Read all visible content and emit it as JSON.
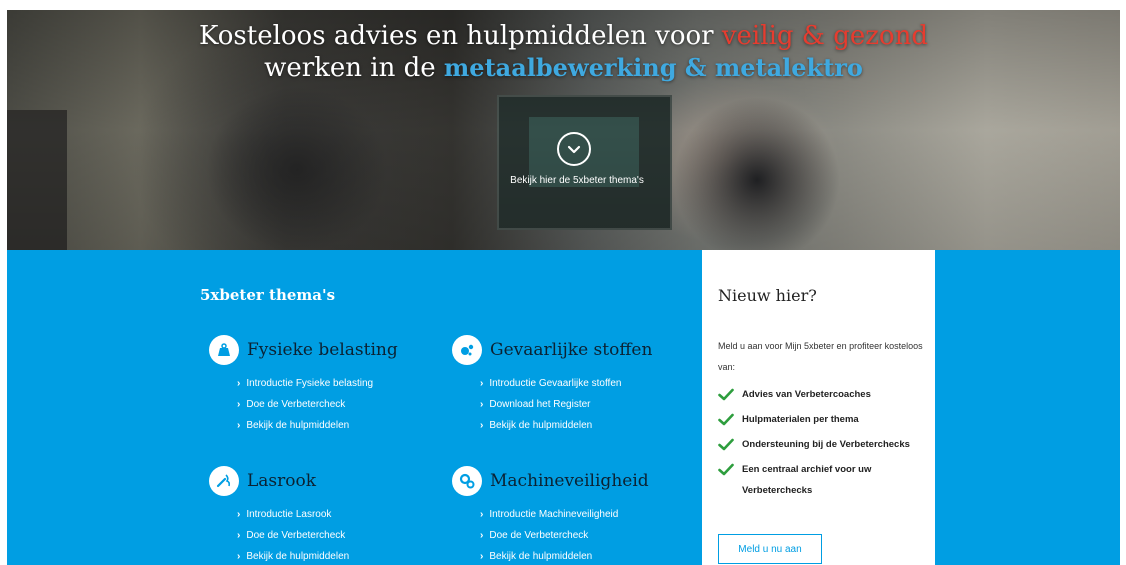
{
  "hero": {
    "title_line1_plain": "Kosteloos advies en hulpmiddelen voor ",
    "title_line1_highlight": "veilig & gezond",
    "title_line2_plain": "werken in de ",
    "title_line2_highlight": "metaalbewerking & metalektro",
    "chevron_label": "Bekijk hier de 5xbeter thema's",
    "highlight_red": "#e63c2f",
    "highlight_blue": "#3fa9e0"
  },
  "themes": {
    "heading": "5xbeter thema's",
    "items": [
      {
        "title": "Fysieke belasting",
        "icon": "weight-icon",
        "links": [
          "Introductie Fysieke belasting",
          "Doe de Verbetercheck",
          "Bekijk de hulpmiddelen"
        ]
      },
      {
        "title": "Gevaarlijke stoffen",
        "icon": "chemical-icon",
        "links": [
          "Introductie Gevaarlijke stoffen",
          "Download het Register",
          "Bekijk de hulpmiddelen"
        ]
      },
      {
        "title": "Lasrook",
        "icon": "welding-icon",
        "links": [
          "Introductie Lasrook",
          "Doe de Verbetercheck",
          "Bekijk de hulpmiddelen"
        ]
      },
      {
        "title": "Machineveiligheid",
        "icon": "gears-icon",
        "links": [
          "Introductie Machineveiligheid",
          "Doe de Verbetercheck",
          "Bekijk de hulpmiddelen"
        ]
      }
    ]
  },
  "nieuw": {
    "title": "Nieuw hier?",
    "intro": "Meld u aan voor Mijn 5xbeter en profiteer kosteloos van:",
    "benefits": [
      "Advies van Verbetercoaches",
      "Hulpmaterialen per thema",
      "Ondersteuning bij de Verbeterchecks",
      "Een centraal archief voor uw Verbeterchecks"
    ],
    "button": "Meld u nu aan"
  },
  "colors": {
    "brand_blue": "#009ee3",
    "check_green": "#2e9e3e"
  }
}
